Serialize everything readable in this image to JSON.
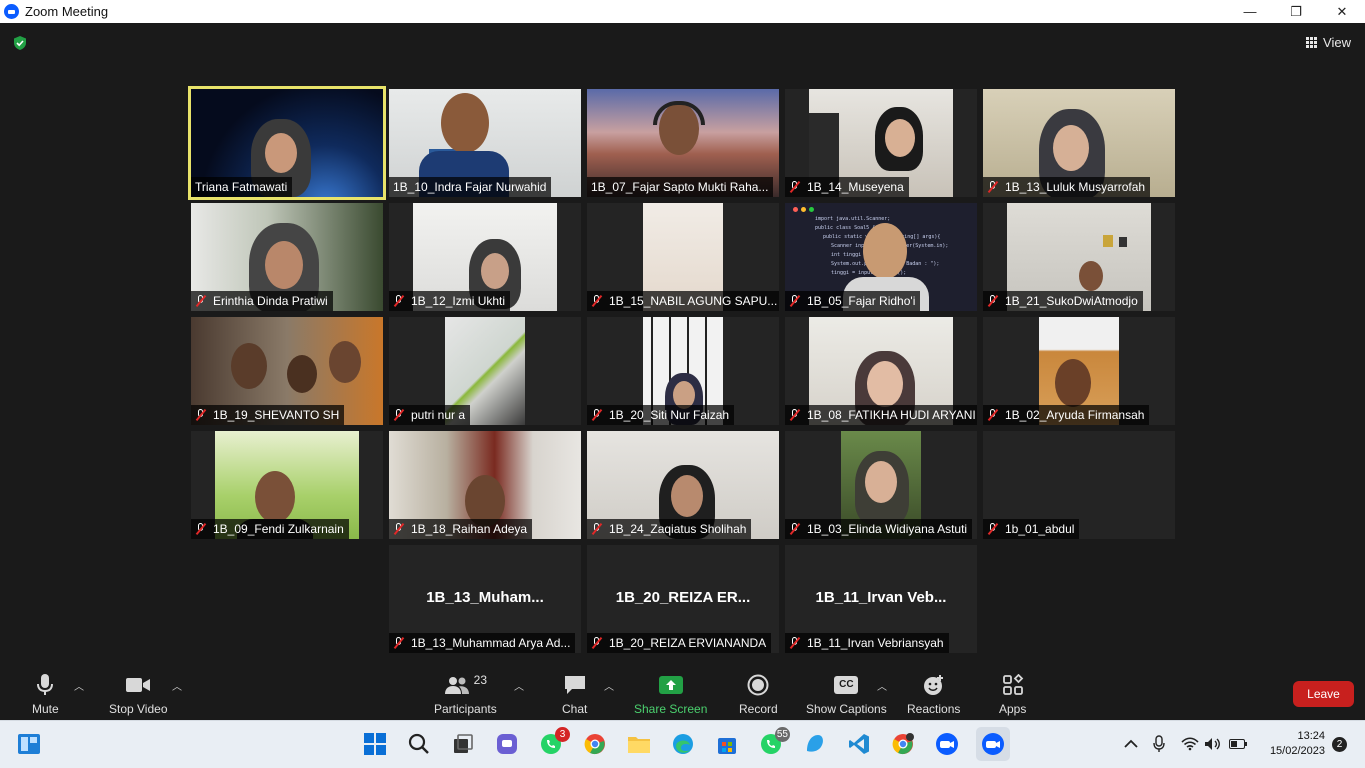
{
  "window": {
    "title": "Zoom Meeting",
    "minimize": "—",
    "maximize": "❐",
    "close": "✕"
  },
  "top": {
    "view_label": "View"
  },
  "participants": [
    {
      "name": "Triana Fatmawati",
      "muted": false
    },
    {
      "name": "1B_10_Indra Fajar Nurwahid",
      "muted": false
    },
    {
      "name": "1B_07_Fajar Sapto Mukti Raha...",
      "muted": false
    },
    {
      "name": "1B_14_Museyena",
      "muted": true
    },
    {
      "name": "1B_13_Luluk Musyarrofah",
      "muted": true
    },
    {
      "name": "Erinthia Dinda Pratiwi",
      "muted": true
    },
    {
      "name": "1B_12_Izmi Ukhti",
      "muted": true
    },
    {
      "name": "1B_15_NABIL AGUNG SAPU...",
      "muted": true
    },
    {
      "name": "1B_05_Fajar Ridho'i",
      "muted": true
    },
    {
      "name": "1B_21_SukoDwiAtmodjo",
      "muted": true
    },
    {
      "name": "1B_19_SHEVANTO SH",
      "muted": true
    },
    {
      "name": "putri nur a",
      "muted": true
    },
    {
      "name": "1B_20_Siti Nur Faizah",
      "muted": true
    },
    {
      "name": "1B_08_FATIKHA HUDI ARYANI",
      "muted": true
    },
    {
      "name": "1B_02_Aryuda Firmansah",
      "muted": true
    },
    {
      "name": "1B_09_Fendi Zulkarnain",
      "muted": true
    },
    {
      "name": "1B_18_Raihan Adeya",
      "muted": true
    },
    {
      "name": "1B_24_Zaqiatus Sholihah",
      "muted": true
    },
    {
      "name": "1B_03_Elinda Widiyana Astuti",
      "muted": true
    },
    {
      "name": "1b_01_abdul",
      "muted": true
    },
    {
      "name": "1B_13_Muhammad Arya Ad...",
      "muted": true,
      "display": "1B_13_Muham..."
    },
    {
      "name": "1B_20_REIZA ERVIANANDA",
      "muted": true,
      "display": "1B_20_REIZA ER..."
    },
    {
      "name": "1B_11_Irvan Vebriansyah",
      "muted": true,
      "display": "1B_11_Irvan Veb..."
    }
  ],
  "code_lines": [
    "import java.util.Scanner;",
    "public class Soal5 {",
    "public static void main(String[] args){",
    "Scanner input = new Scanner(System.in);",
    "int tinggi",
    "System.out.print(\"Tinggi Badan : \");",
    "tinggi = input.nextInt();"
  ],
  "toolbar": {
    "mute": "Mute",
    "stop_video": "Stop Video",
    "participants": "Participants",
    "participant_count": "23",
    "chat": "Chat",
    "share_screen": "Share Screen",
    "record": "Record",
    "show_captions": "Show Captions",
    "cc": "CC",
    "reactions": "Reactions",
    "apps": "Apps",
    "leave": "Leave"
  },
  "taskbar": {
    "whatsapp_badge": "3",
    "whatsapp2_badge": "55",
    "time": "13:24",
    "date": "15/02/2023",
    "notifications": "2"
  },
  "colors": {
    "accent_green": "#22a045",
    "leave_red": "#c8201e",
    "active_speaker": "#e8e36a",
    "zoom_blue": "#0b5cff"
  }
}
